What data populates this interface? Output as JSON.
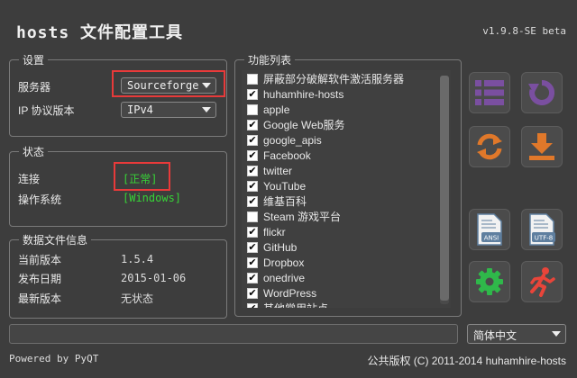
{
  "app": {
    "title": "hosts 文件配置工具",
    "version": "v1.9.8-SE beta"
  },
  "settings": {
    "legend": "设置",
    "server_label": "服务器",
    "server_value": "Sourceforge",
    "ip_label": "IP 协议版本",
    "ip_value": "IPv4"
  },
  "status": {
    "legend": "状态",
    "connection_label": "连接",
    "connection_value": "[正常]",
    "os_label": "操作系统",
    "os_value": "[Windows]"
  },
  "datafile": {
    "legend": "数据文件信息",
    "current_label": "当前版本",
    "current_value": "1.5.4",
    "release_label": "发布日期",
    "release_value": "2015-01-06",
    "latest_label": "最新版本",
    "latest_value": "无状态"
  },
  "functions": {
    "legend": "功能列表",
    "items": [
      {
        "label": "屏蔽部分破解软件激活服务器",
        "checked": false
      },
      {
        "label": "huhamhire-hosts",
        "checked": true
      },
      {
        "label": "apple",
        "checked": false
      },
      {
        "label": "Google Web服务",
        "checked": true
      },
      {
        "label": "google_apis",
        "checked": true
      },
      {
        "label": "Facebook",
        "checked": true
      },
      {
        "label": "twitter",
        "checked": true
      },
      {
        "label": "YouTube",
        "checked": true
      },
      {
        "label": "维基百科",
        "checked": true
      },
      {
        "label": "Steam 游戏平台",
        "checked": false
      },
      {
        "label": "flickr",
        "checked": true
      },
      {
        "label": "GitHub",
        "checked": true
      },
      {
        "label": "Dropbox",
        "checked": true
      },
      {
        "label": "onedrive",
        "checked": true
      },
      {
        "label": "WordPress",
        "checked": true
      },
      {
        "label": "其他常用站点",
        "checked": true
      }
    ]
  },
  "buttons": {
    "ansi_label": "ANSI",
    "utf8_label": "UTF-8"
  },
  "language": {
    "value": "简体中文"
  },
  "footer": {
    "powered": "Powered by PyQT",
    "copyright": "公共版权 (C) 2011-2014 huhamhire-hosts"
  },
  "colors": {
    "accent_purple": "#7a4fa0",
    "accent_orange": "#e0782a",
    "accent_green": "#2fb84a",
    "accent_red": "#e8453a",
    "status_green": "#37d437",
    "highlight_box": "#e83a3a"
  }
}
